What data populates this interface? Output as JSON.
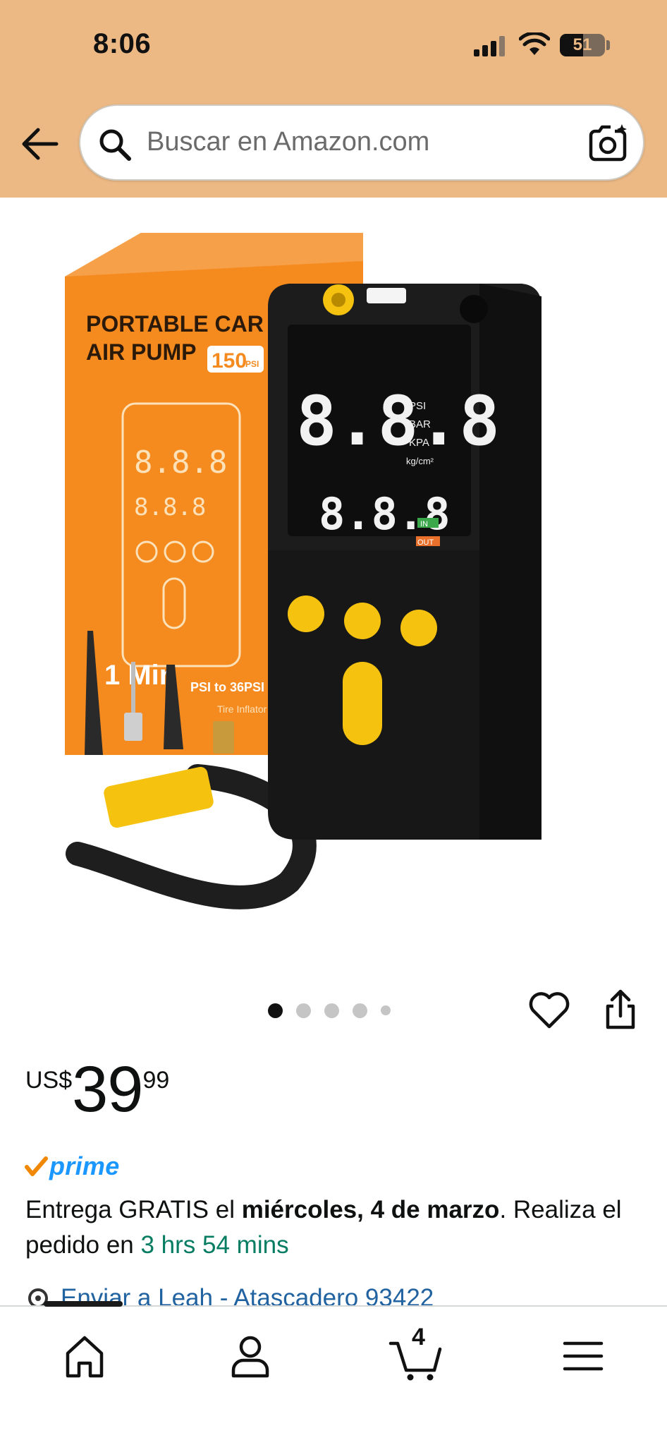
{
  "status_bar": {
    "time": "8:06",
    "battery": "51",
    "battery_level": 0.51,
    "icons": [
      "signal-icon",
      "wifi-icon",
      "battery-icon"
    ]
  },
  "header": {
    "search_placeholder": "Buscar en Amazon.com",
    "icons": [
      "back-arrow-icon",
      "search-icon",
      "camera-icon"
    ]
  },
  "product_image": {
    "box_text_line1": "PORTABLE CAR",
    "box_text_line2": "AIR PUMP",
    "box_badge": "150",
    "box_badge_unit": "PSI",
    "box_small_line": "1 Min",
    "box_range": "PSI to 36PSI",
    "box_sub": "Tire Inflator",
    "display_units": [
      "PSI",
      "BAR",
      "KPA",
      "kg/cm²"
    ],
    "display_digits": "8.8.8",
    "display_digits_small": "8.8.8",
    "tag_in": "IN",
    "tag_out": "OUT"
  },
  "carousel": {
    "count": 5,
    "active_index": 0
  },
  "price": {
    "currency": "US$",
    "whole": "39",
    "fraction": "99"
  },
  "prime_label": "prime",
  "delivery": {
    "prefix": "Entrega GRATIS el ",
    "date": "miércoles, 4 de marzo",
    "middle": ". Realiza el pedido en ",
    "countdown": "3 hrs 54 mins"
  },
  "ship_to": "Enviar a Leah - Atascadero 93422",
  "nav": {
    "cart_count": "4",
    "items": [
      "home-icon",
      "account-icon",
      "cart-icon",
      "menu-icon"
    ]
  },
  "colors": {
    "header_bg": "#ecb984",
    "prime_blue": "#1a98ff",
    "link_blue": "#2162a1",
    "countdown_green": "#067d62",
    "box_orange": "#f58a1f",
    "device_black": "#1c1c1c",
    "button_yellow": "#f5c20f"
  }
}
